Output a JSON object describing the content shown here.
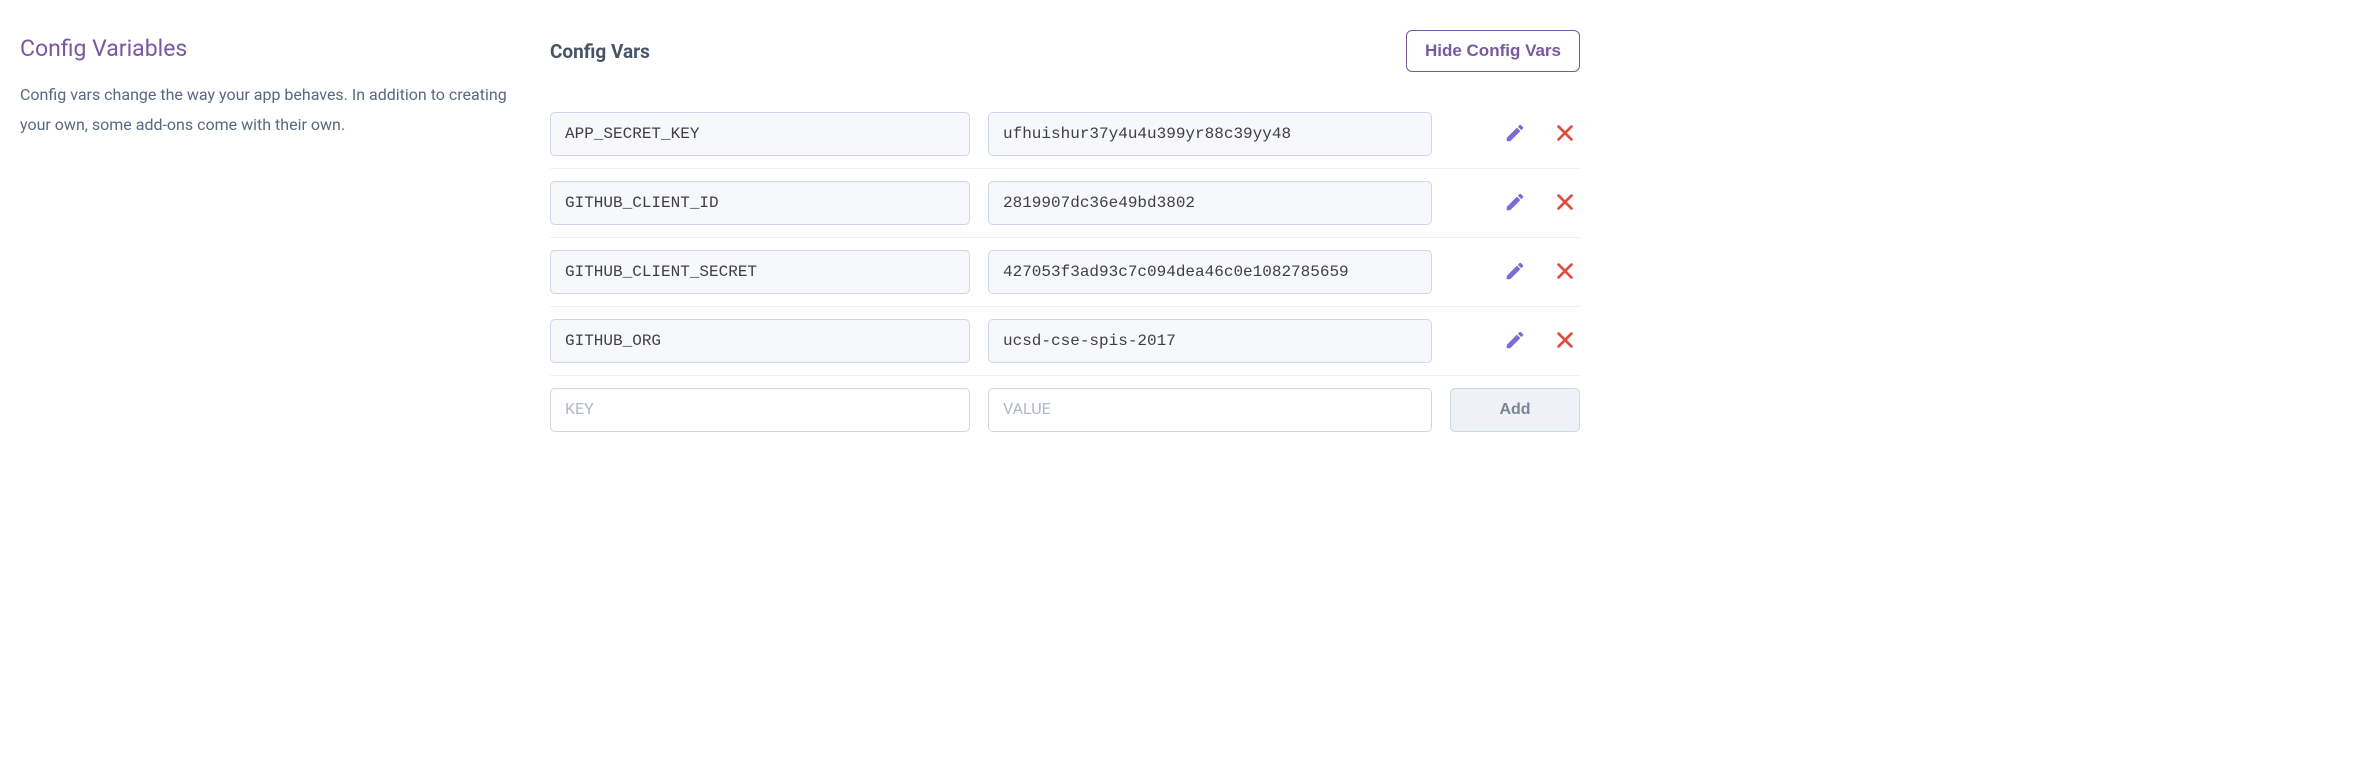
{
  "sidebar": {
    "title": "Config Variables",
    "description": "Config vars change the way your app behaves. In addition to creating your own, some add-ons come with their own."
  },
  "main": {
    "section_title": "Config Vars",
    "hide_button": "Hide Config Vars",
    "vars": [
      {
        "key": "APP_SECRET_KEY",
        "value": "ufhuishur37y4u4u399yr88c39yy48"
      },
      {
        "key": "GITHUB_CLIENT_ID",
        "value": "2819907dc36e49bd3802"
      },
      {
        "key": "GITHUB_CLIENT_SECRET",
        "value": "427053f3ad93c7c094dea46c0e1082785659"
      },
      {
        "key": "GITHUB_ORG",
        "value": "ucsd-cse-spis-2017"
      }
    ],
    "new_row": {
      "key_placeholder": "KEY",
      "value_placeholder": "VALUE",
      "add_button": "Add"
    }
  }
}
